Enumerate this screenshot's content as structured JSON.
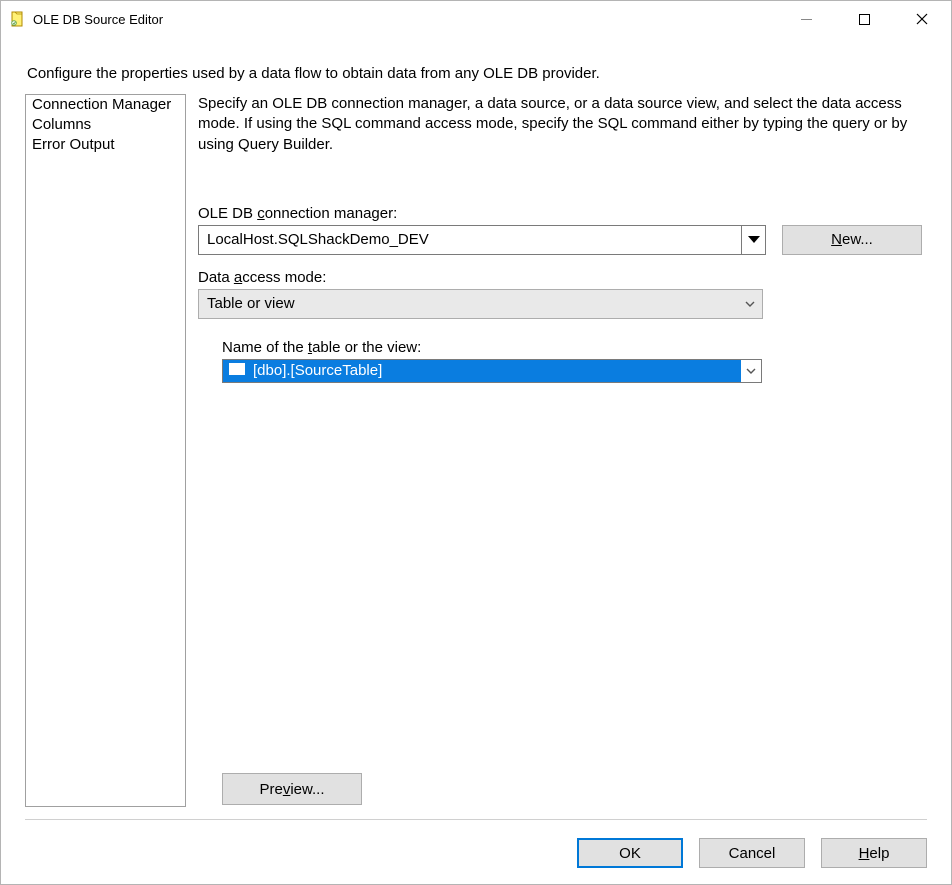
{
  "window": {
    "title": "OLE DB Source Editor"
  },
  "intro": "Configure the properties used by a data flow to obtain data from any OLE DB provider.",
  "sidebar": {
    "items": [
      {
        "label": "Connection Manager"
      },
      {
        "label": "Columns"
      },
      {
        "label": "Error Output"
      }
    ]
  },
  "main": {
    "description": "Specify an OLE DB connection manager, a data source, or a data source view, and select the data access mode. If using the SQL command access mode, specify the SQL command either by typing the query or by using Query Builder.",
    "conn_label_pre": "OLE DB ",
    "conn_label_u": "c",
    "conn_label_post": "onnection manager:",
    "conn_value": "LocalHost.SQLShackDemo_DEV",
    "new_btn_u": "N",
    "new_btn_post": "ew...",
    "dam_label_pre": "Data ",
    "dam_label_u": "a",
    "dam_label_post": "ccess mode:",
    "dam_value": "Table or view",
    "table_label_pre": "Name of the ",
    "table_label_u": "t",
    "table_label_post": "able or the view:",
    "table_value": "[dbo].[SourceTable]",
    "preview_pre": "Pre",
    "preview_u": "v",
    "preview_post": "iew..."
  },
  "footer": {
    "ok": "OK",
    "cancel": "Cancel",
    "help_u": "H",
    "help_post": "elp"
  }
}
